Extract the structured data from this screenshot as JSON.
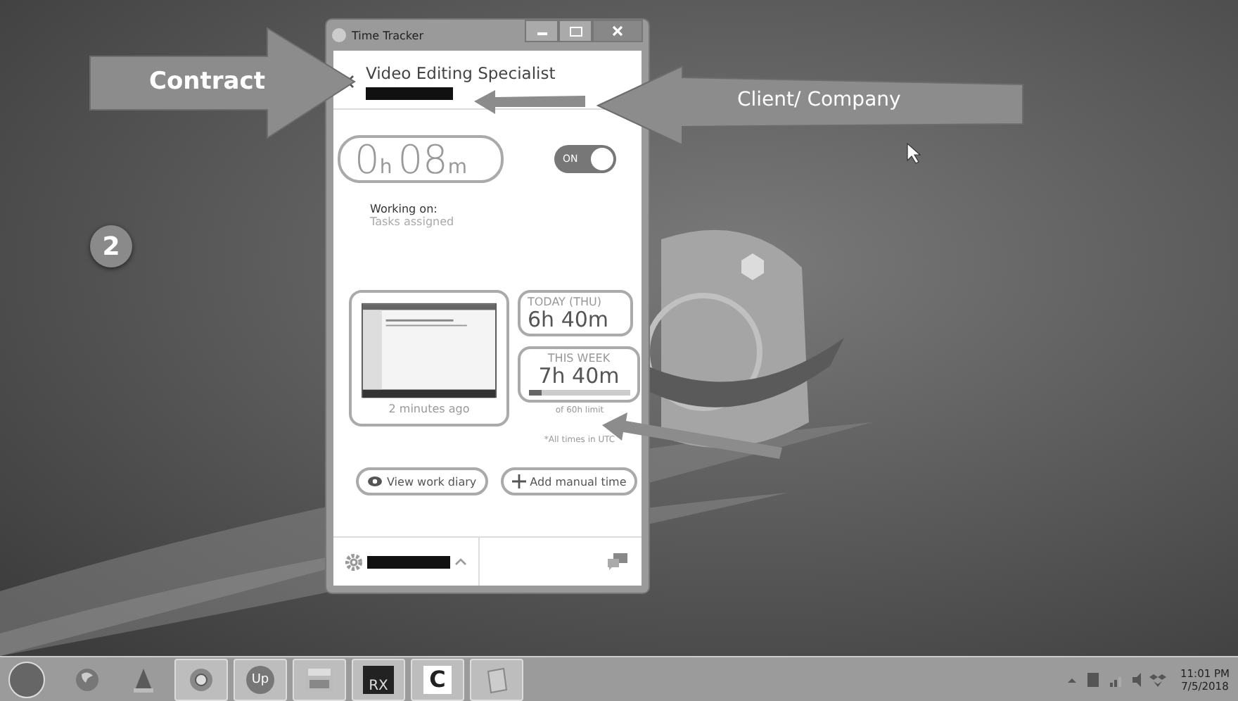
{
  "window": {
    "title": "Time Tracker"
  },
  "header": {
    "title": "Video Editing Specialist",
    "client_redacted": true
  },
  "timer": {
    "hours": "0",
    "hours_unit": "h",
    "minutes": "08",
    "minutes_unit": "m"
  },
  "toggle": {
    "label": "ON",
    "on": true
  },
  "working_on": {
    "label": "Working on:",
    "value": "Tasks assigned"
  },
  "screenshot": {
    "caption": "2 minutes ago"
  },
  "today": {
    "label": "TODAY (THU)",
    "value": "6h 40m"
  },
  "week": {
    "label": "THIS WEEK",
    "value": "7h 40m",
    "level": 0.13,
    "limit": "of 60h limit"
  },
  "note": "*All times in UTC",
  "buttons": [
    {
      "kind": "eye",
      "label": "View work diary"
    },
    {
      "kind": "plus",
      "label": "Add manual time"
    }
  ],
  "footer": {
    "user_redacted": true
  },
  "annotations": [
    {
      "kind": "right",
      "text": "Contract"
    },
    {
      "kind": "left",
      "text": "Client/ Company"
    }
  ],
  "step": "2",
  "taskbar": {
    "apps": [
      {
        "kind": "start"
      },
      {
        "kind": "firefox",
        "active": false
      },
      {
        "kind": "vlc",
        "active": false
      },
      {
        "kind": "chrome",
        "active": true
      },
      {
        "kind": "text",
        "label": "Up",
        "active": true
      },
      {
        "kind": "explorer",
        "active": true
      },
      {
        "kind": "text-dark",
        "label": "RX",
        "active": true
      },
      {
        "kind": "text-white",
        "label": "C",
        "active": true
      },
      {
        "kind": "notepad",
        "active": true
      }
    ],
    "time": "11:01 PM",
    "date": "7/5/2018"
  }
}
